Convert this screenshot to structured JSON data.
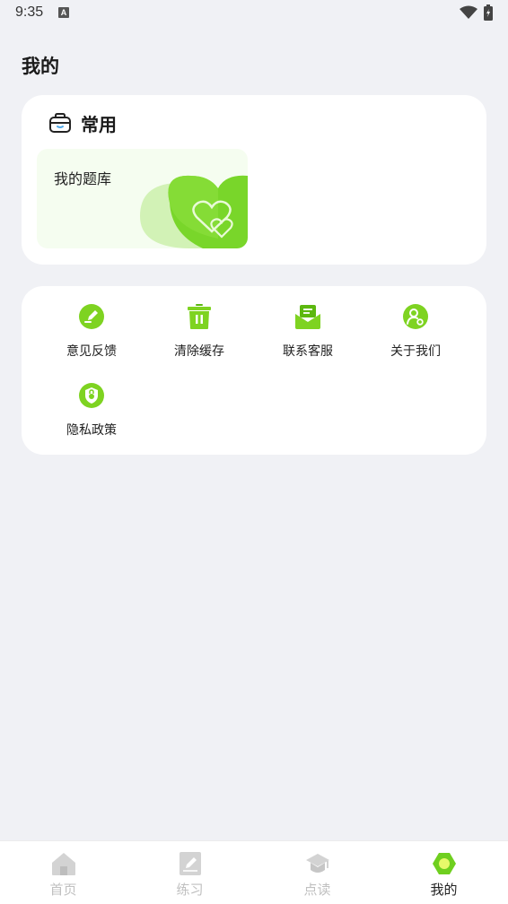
{
  "status_bar": {
    "time": "9:35",
    "notification_badge": "A"
  },
  "page": {
    "title": "我的"
  },
  "common_section": {
    "title": "常用",
    "items": [
      {
        "label": "我的题库",
        "icon": "hearts-icon"
      }
    ]
  },
  "tools": [
    {
      "label": "意见反馈",
      "icon": "feedback-pen-icon"
    },
    {
      "label": "清除缓存",
      "icon": "trash-icon"
    },
    {
      "label": "联系客服",
      "icon": "mail-tray-icon"
    },
    {
      "label": "关于我们",
      "icon": "user-settings-icon"
    },
    {
      "label": "隐私政策",
      "icon": "privacy-lock-icon"
    }
  ],
  "tabbar": {
    "tabs": [
      {
        "label": "首页",
        "icon": "home-icon",
        "active": false
      },
      {
        "label": "练习",
        "icon": "notebook-pen-icon",
        "active": false
      },
      {
        "label": "点读",
        "icon": "graduation-cap-icon",
        "active": false
      },
      {
        "label": "我的",
        "icon": "profile-hexagon-icon",
        "active": true
      }
    ]
  },
  "colors": {
    "accent": "#7ed321",
    "accent_dark": "#5cb80f",
    "background": "#f0f1f5",
    "inactive_tab": "#c0c0c0"
  }
}
